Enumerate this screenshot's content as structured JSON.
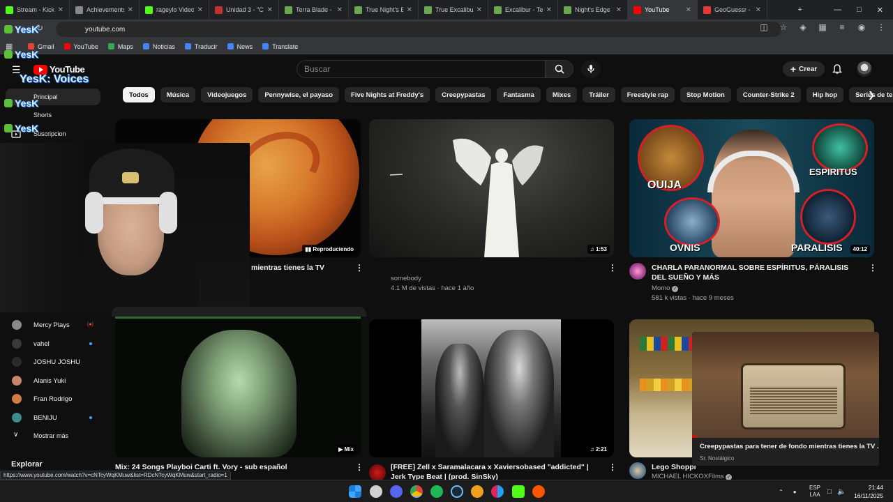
{
  "browser": {
    "tabs": [
      {
        "title": "Stream - Kick",
        "color": "#53fc18",
        "active": false
      },
      {
        "title": "Achievements",
        "color": "#888888",
        "active": false
      },
      {
        "title": "rageylo Videos",
        "color": "#53fc18",
        "active": false
      },
      {
        "title": "Unidad 3 - \"Cu",
        "color": "#c4302b",
        "active": false
      },
      {
        "title": "Terra Blade - Te",
        "color": "#6aa84f",
        "active": false
      },
      {
        "title": "True Night's Ed",
        "color": "#6aa84f",
        "active": false
      },
      {
        "title": "True Excalibur",
        "color": "#6aa84f",
        "active": false
      },
      {
        "title": "Excalibur - Terr",
        "color": "#6aa84f",
        "active": false
      },
      {
        "title": "Night's Edge - ",
        "color": "#6aa84f",
        "active": false
      },
      {
        "title": "YouTube",
        "color": "#ff0000",
        "active": true
      },
      {
        "title": "GeoGuessr - L",
        "color": "#e53935",
        "active": false
      }
    ],
    "address": "youtube.com",
    "bookmarks": [
      {
        "label": "Gmail",
        "color": "#ea4335"
      },
      {
        "label": "YouTube",
        "color": "#ff0000"
      },
      {
        "label": "Maps",
        "color": "#34a853"
      },
      {
        "label": "Noticias",
        "color": "#4285f4"
      },
      {
        "label": "Traducir",
        "color": "#4285f4"
      },
      {
        "label": "News",
        "color": "#4285f4"
      },
      {
        "label": "Translate",
        "color": "#4285f4"
      }
    ],
    "status_url": "https://www.youtube.com/watch?v=cNTcyWqKMuw&list=RDcNTcyWqKMuw&start_radio=1"
  },
  "youtube": {
    "logo_text": "YouTube",
    "search_placeholder": "Buscar",
    "create_label": "Crear",
    "chips": [
      "Todos",
      "Música",
      "Videojuegos",
      "Pennywise, el payaso",
      "Five Nights at Freddy's",
      "Creepypastas",
      "Fantasma",
      "Mixes",
      "Tráiler",
      "Freestyle rap",
      "Stop Motion",
      "Counter-Strike 2",
      "Hip hop",
      "Series de televisión"
    ],
    "sidebar": {
      "principal": "Principal",
      "shorts": "Shorts",
      "subscriptions": "Suscripcion",
      "subs": [
        {
          "name": "Mercy Plays",
          "color": "#8a8a8a",
          "state": "live"
        },
        {
          "name": "vahel",
          "color": "#3a3a3a",
          "state": "dot"
        },
        {
          "name": "JOSHU JOSHU",
          "color": "#2a2a2a",
          "state": "none"
        },
        {
          "name": "Alanis Yuki",
          "color": "#c9856a",
          "state": "none"
        },
        {
          "name": "Fran Rodrigo",
          "color": "#d07a44",
          "state": "none"
        },
        {
          "name": "BENIJU",
          "color": "#3d8c8c",
          "state": "dot"
        }
      ],
      "show_more": "Mostrar más",
      "explore": "Explorar"
    },
    "videos": [
      {
        "title_visible": "mientras tienes la TV",
        "badge": "Reproduciendo",
        "channel": "",
        "meta": ""
      },
      {
        "title_visible": "",
        "badge": "1:53",
        "channel": "somebody",
        "meta": "4.1 M de vistas · hace 1 año"
      },
      {
        "title_visible": "CHARLA PARANORMAL SOBRE ESPÍRITUS, PÁRALISIS DEL SUEÑO Y MÁS",
        "badge": "40:12",
        "channel": "Momo",
        "meta": "581 k vistas · hace 9 meses",
        "thumb_words": [
          "OUIJA",
          "ESPIRITUS",
          "OVNIS",
          "PARALISIS"
        ]
      },
      {
        "title_visible": "Mix: 24 Songs Playboi Carti ft. Vory - sub español",
        "badge": "Mix",
        "channel": "",
        "meta": ""
      },
      {
        "title_visible": "[FREE] Zell x Saramalacara x Xaviersobased \"addicted\" | Jerk Type Beat | (prod. SinSky)",
        "badge": "2:21",
        "channel": "",
        "meta": ""
      },
      {
        "title_visible": "Lego Shoppi",
        "badge": "",
        "channel": "MICHAEL HICKOXFilms",
        "meta": ""
      }
    ],
    "miniplayer": {
      "title": "Creepypastas para tener de fondo mientras tienes la TV ...",
      "channel": "Sr. Nostálgico"
    }
  },
  "overlay": {
    "yesk_text": "YesK",
    "yesk_voices": "YesK: Voices"
  },
  "taskbar": {
    "lang_top": "ESP",
    "lang_bottom": "LAA",
    "time": "21:44",
    "date": "16/11/2025"
  }
}
